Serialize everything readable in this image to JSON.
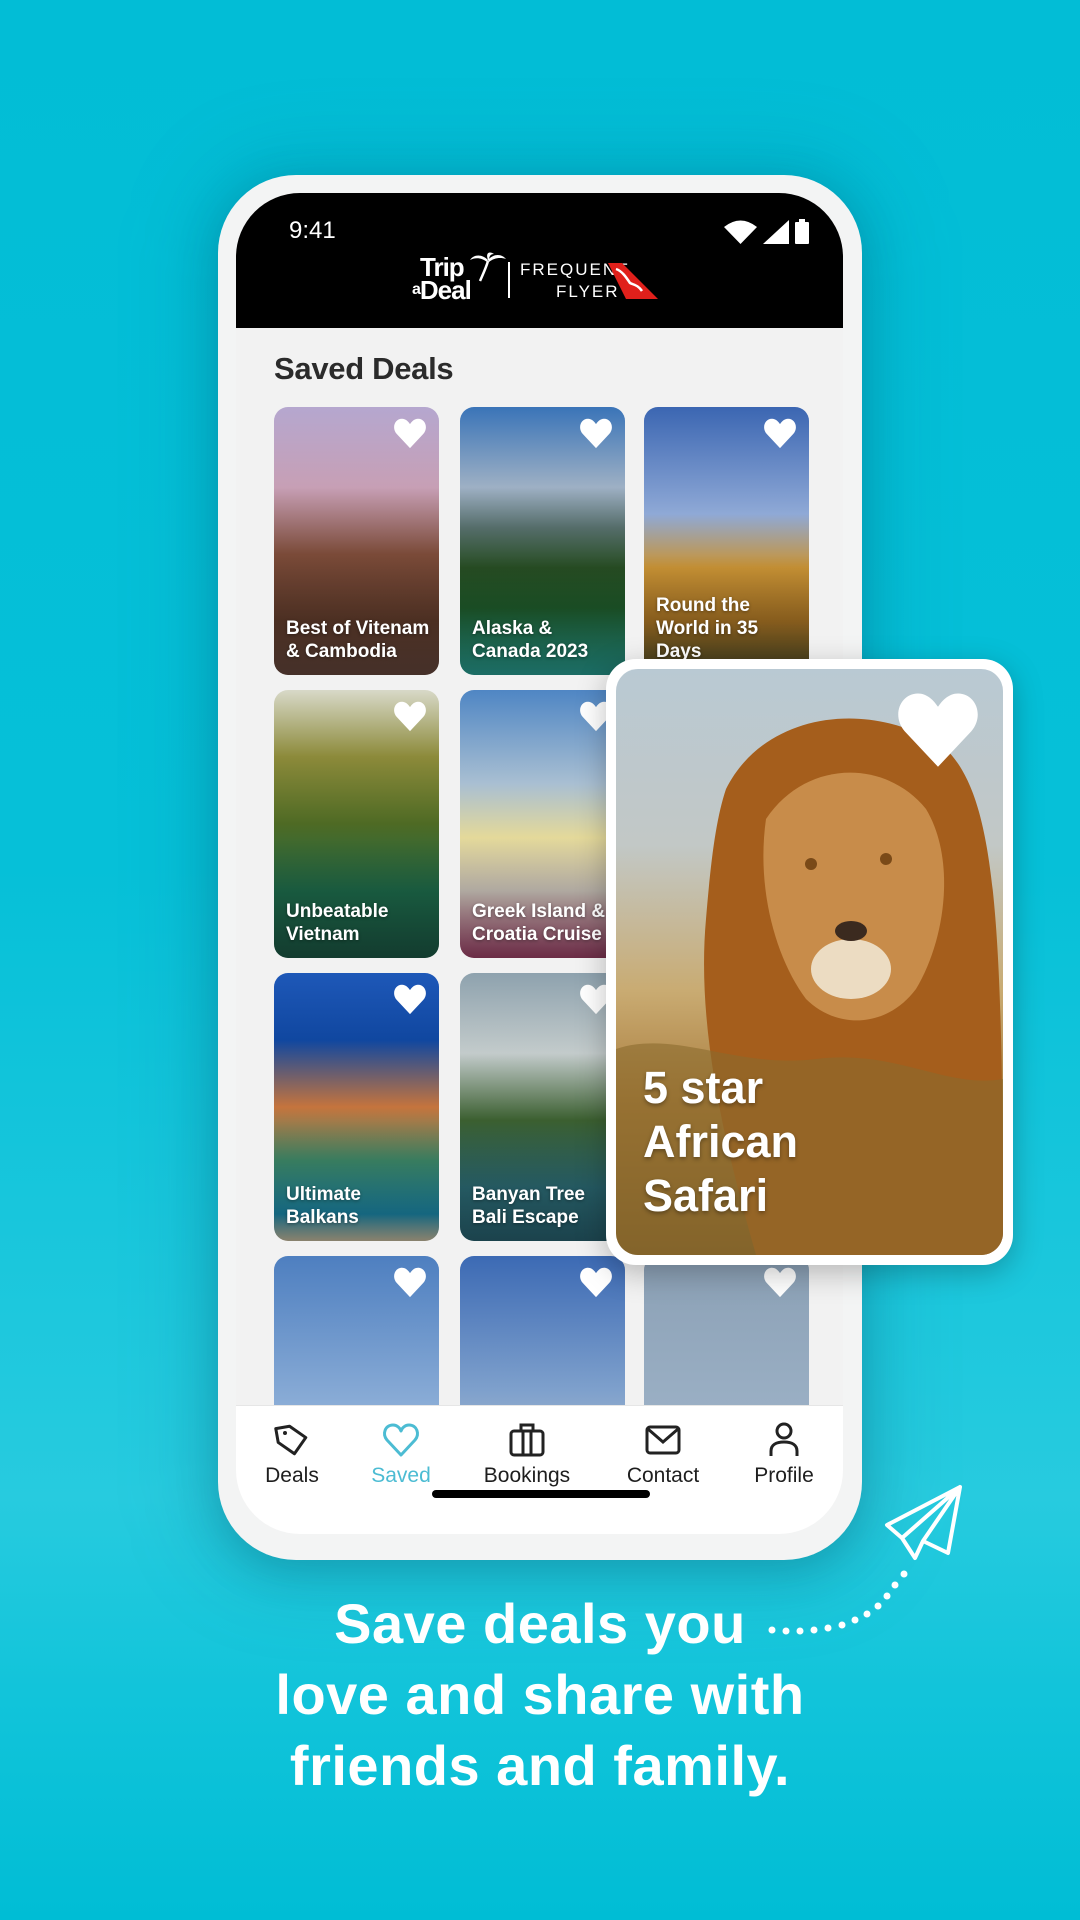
{
  "status_bar": {
    "time": "9:41",
    "icons": [
      "wifi-icon",
      "cellular-signal-icon",
      "battery-icon"
    ]
  },
  "header": {
    "logo_trip": "Trip",
    "logo_a": "a",
    "logo_deal": "Deal",
    "logo_frequent": "FREQUENT",
    "logo_flyer": "FLYER"
  },
  "page": {
    "title": "Saved Deals"
  },
  "deals": [
    {
      "title": "Best of Vitenam & Cambodia",
      "saved": true
    },
    {
      "title": "Alaska & Canada 2023",
      "saved": true
    },
    {
      "title": "Round the World in 35 Days",
      "saved": true
    },
    {
      "title": "Unbeatable Vietnam",
      "saved": true
    },
    {
      "title": "Greek Island & Croatia Cruise",
      "saved": true
    },
    {
      "title": "",
      "saved": true
    },
    {
      "title": "Ultimate Balkans",
      "saved": true
    },
    {
      "title": "Banyan Tree Bali Escape",
      "saved": true
    },
    {
      "title": "",
      "saved": true
    },
    {
      "title": "",
      "saved": true
    },
    {
      "title": "",
      "saved": true
    },
    {
      "title": "",
      "saved": true
    }
  ],
  "featured_deal": {
    "title_lines": [
      "5 star",
      "African",
      "Safari"
    ],
    "saved": true
  },
  "nav": {
    "items": [
      {
        "label": "Deals",
        "icon": "tag-icon",
        "active": false
      },
      {
        "label": "Saved",
        "icon": "heart-icon",
        "active": true
      },
      {
        "label": "Bookings",
        "icon": "briefcase-icon",
        "active": false
      },
      {
        "label": "Contact",
        "icon": "envelope-icon",
        "active": false
      },
      {
        "label": "Profile",
        "icon": "person-icon",
        "active": false
      }
    ],
    "active_color": "#4cbcd3"
  },
  "tagline": {
    "lines": [
      "Save deals you",
      "love and share with",
      "friends and family."
    ]
  },
  "colors": {
    "background": "#02bdd6",
    "accent": "#4cbcd3",
    "header": "#000000",
    "qantas_red": "#e0201b"
  }
}
